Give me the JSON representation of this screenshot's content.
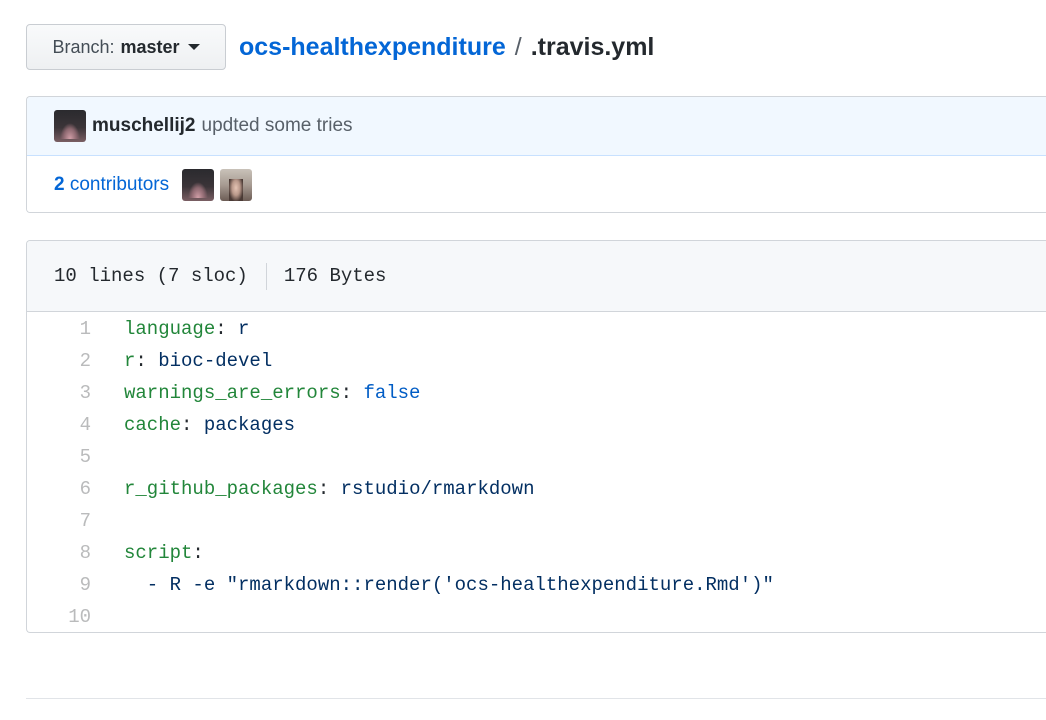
{
  "branch": {
    "label": "Branch:",
    "value": "master"
  },
  "breadcrumb": {
    "repo": "ocs-healthexpenditure",
    "separator": "/",
    "file": ".travis.yml"
  },
  "commit": {
    "author": "muschellij2",
    "message": "updted some tries"
  },
  "contributors": {
    "count": "2",
    "label": "contributors"
  },
  "file_info": {
    "lines": "10 lines (7 sloc)",
    "size": "176 Bytes"
  },
  "code_lines": [
    {
      "num": "1",
      "key": "language",
      "colon": ":",
      "value": " r",
      "value_type": "s"
    },
    {
      "num": "2",
      "key": "r",
      "colon": ":",
      "value": " bioc-devel",
      "value_type": "s"
    },
    {
      "num": "3",
      "key": "warnings_are_errors",
      "colon": ":",
      "value": " false",
      "value_type": "c"
    },
    {
      "num": "4",
      "key": "cache",
      "colon": ":",
      "value": " packages",
      "value_type": "s"
    },
    {
      "num": "5",
      "key": "",
      "colon": "",
      "value": "",
      "value_type": "s"
    },
    {
      "num": "6",
      "key": "r_github_packages",
      "colon": ":",
      "value": " rstudio/rmarkdown",
      "value_type": "s"
    },
    {
      "num": "7",
      "key": "",
      "colon": "",
      "value": "",
      "value_type": "s"
    },
    {
      "num": "8",
      "key": "script",
      "colon": ":",
      "value": "",
      "value_type": "s"
    },
    {
      "num": "9",
      "key": "",
      "colon": "",
      "value": "  - R -e \"rmarkdown::render('ocs-healthexpenditure.Rmd')\"",
      "value_type": "s"
    },
    {
      "num": "10",
      "key": "",
      "colon": "",
      "value": "",
      "value_type": "s"
    }
  ],
  "colors": {
    "link": "#0366d6",
    "yaml_key": "#22863a",
    "yaml_string": "#032f62",
    "yaml_constant": "#005cc5",
    "commit_bg": "#f1f8ff"
  },
  "icons": [
    "caret-down-icon",
    "author-avatar",
    "contributor-avatar"
  ]
}
